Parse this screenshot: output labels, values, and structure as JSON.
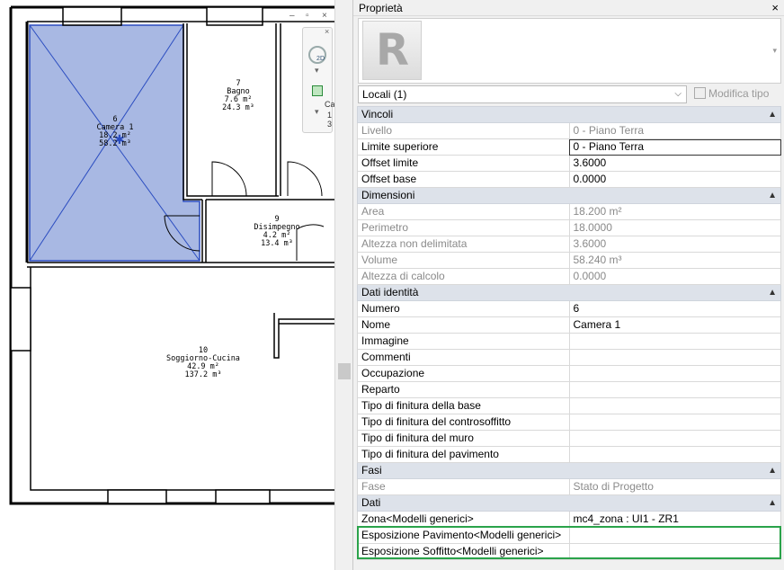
{
  "palette": {
    "title": "Proprietà",
    "close_glyph": "×"
  },
  "type_selector": {
    "logo": "R",
    "instance": "Locali (1)",
    "edit_type_label": "Modifica tipo"
  },
  "groups": [
    {
      "name": "Vincoli",
      "rows": [
        {
          "label": "Livello",
          "value": "0 - Piano Terra",
          "ro": true
        },
        {
          "label": "Limite superiore",
          "value": "0 - Piano Terra",
          "ro": false
        },
        {
          "label": "Offset limite",
          "value": "3.6000",
          "ro": false
        },
        {
          "label": "Offset base",
          "value": "0.0000",
          "ro": false
        }
      ]
    },
    {
      "name": "Dimensioni",
      "rows": [
        {
          "label": "Area",
          "value": "18.200 m²",
          "ro": true
        },
        {
          "label": "Perimetro",
          "value": "18.0000",
          "ro": true
        },
        {
          "label": "Altezza non delimitata",
          "value": "3.6000",
          "ro": true
        },
        {
          "label": "Volume",
          "value": "58.240 m³",
          "ro": true
        },
        {
          "label": "Altezza di calcolo",
          "value": "0.0000",
          "ro": true
        }
      ]
    },
    {
      "name": "Dati identità",
      "rows": [
        {
          "label": "Numero",
          "value": "6",
          "ro": false
        },
        {
          "label": "Nome",
          "value": "Camera 1",
          "ro": false
        },
        {
          "label": "Immagine",
          "value": "",
          "ro": false
        },
        {
          "label": "Commenti",
          "value": "",
          "ro": false
        },
        {
          "label": "Occupazione",
          "value": "",
          "ro": false
        },
        {
          "label": "Reparto",
          "value": "",
          "ro": false
        },
        {
          "label": "Tipo di finitura della base",
          "value": "",
          "ro": false
        },
        {
          "label": "Tipo di finitura del controsoffitto",
          "value": "",
          "ro": false
        },
        {
          "label": "Tipo di finitura del muro",
          "value": "",
          "ro": false
        },
        {
          "label": "Tipo di finitura del pavimento",
          "value": "",
          "ro": false
        }
      ]
    },
    {
      "name": "Fasi",
      "rows": [
        {
          "label": "Fase",
          "value": "Stato di Progetto",
          "ro": true
        }
      ]
    },
    {
      "name": "Dati",
      "rows": [
        {
          "label": "Zona<Modelli generici>",
          "value": "mc4_zona : UI1 - ZR1",
          "ro": false
        },
        {
          "label": "Esposizione Pavimento<Modelli generici>",
          "value": "",
          "ro": false
        },
        {
          "label": "Esposizione Soffitto<Modelli generici>",
          "value": "",
          "ro": false
        }
      ]
    }
  ],
  "rooms": [
    {
      "num": "6",
      "name": "Camera 1",
      "area": "18.2 m²",
      "vol": "58.2 m³"
    },
    {
      "num": "7",
      "name": "Bagno",
      "area": "7.6 m²",
      "vol": "24.3 m³"
    },
    {
      "num": "9",
      "name": "Disimpegno",
      "area": "4.2 m²",
      "vol": "13.4 m³"
    },
    {
      "num": "10",
      "name": "Soggiorno-Cucina",
      "area": "42.9 m²",
      "vol": "137.2 m³"
    }
  ],
  "view_control": {
    "label_2d": "2D",
    "cut_1": "Ca",
    "cut_2": "1",
    "cut_3": "3",
    "win_minimize": "–",
    "win_restore": "▫",
    "win_close": "×",
    "close_small": "×",
    "dropdown": "▾"
  },
  "colors": {
    "selection_fill": "#a8b8e3",
    "selection_stroke": "#2a4cc0",
    "highlight": "#2aa34a"
  }
}
